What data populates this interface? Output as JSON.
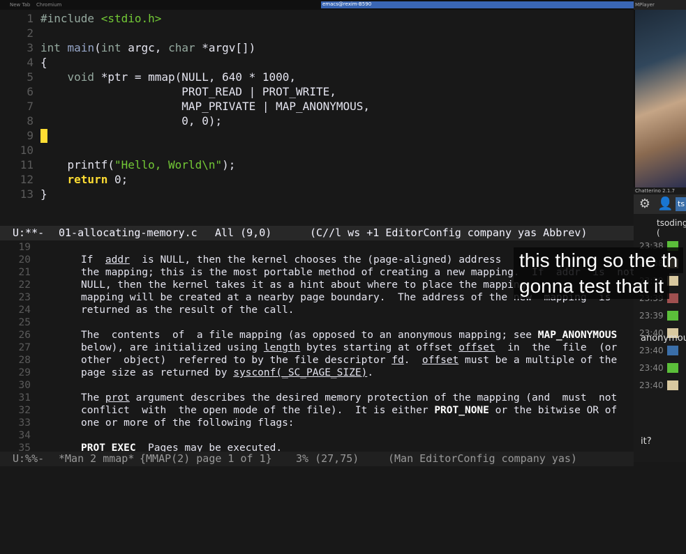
{
  "topbar": {
    "left_tab": "New Tab",
    "left_app": "Chromium",
    "emacs_title": "emacs@rexim-B590",
    "right_title": "MPlayer"
  },
  "code": {
    "lines": [
      {
        "n": "1",
        "parts": [
          {
            "c": "pp",
            "t": "#include "
          },
          {
            "c": "str",
            "t": "<stdio.h>"
          }
        ]
      },
      {
        "n": "2",
        "parts": []
      },
      {
        "n": "3",
        "parts": [
          {
            "c": "ty",
            "t": "int"
          },
          {
            "c": "",
            "t": " "
          },
          {
            "c": "fn",
            "t": "main"
          },
          {
            "c": "",
            "t": "("
          },
          {
            "c": "ty",
            "t": "int"
          },
          {
            "c": "",
            "t": " argc, "
          },
          {
            "c": "ty",
            "t": "char"
          },
          {
            "c": "",
            "t": " *argv[])"
          }
        ]
      },
      {
        "n": "4",
        "parts": [
          {
            "c": "",
            "t": "{"
          }
        ]
      },
      {
        "n": "5",
        "parts": [
          {
            "c": "",
            "t": "    "
          },
          {
            "c": "ty",
            "t": "void"
          },
          {
            "c": "",
            "t": " *ptr = mmap(NULL, 640 * 1000,"
          }
        ]
      },
      {
        "n": "6",
        "parts": [
          {
            "c": "",
            "t": "                     PROT_READ | PROT_WRITE,"
          }
        ]
      },
      {
        "n": "7",
        "parts": [
          {
            "c": "",
            "t": "                     MAP_PRIVATE | MAP_ANONYMOUS,"
          }
        ]
      },
      {
        "n": "8",
        "parts": [
          {
            "c": "",
            "t": "                     0, 0);"
          }
        ]
      },
      {
        "n": "9",
        "parts": []
      },
      {
        "n": "10",
        "parts": []
      },
      {
        "n": "11",
        "parts": [
          {
            "c": "",
            "t": "    printf("
          },
          {
            "c": "str",
            "t": "\"Hello, World\\n\""
          },
          {
            "c": "",
            "t": ");"
          }
        ]
      },
      {
        "n": "12",
        "parts": [
          {
            "c": "",
            "t": "    "
          },
          {
            "c": "kw",
            "t": "return"
          },
          {
            "c": "",
            "t": " 0;"
          }
        ]
      },
      {
        "n": "13",
        "parts": [
          {
            "c": "",
            "t": "}"
          }
        ]
      }
    ]
  },
  "modeline_top": {
    "status": "U:**-",
    "buffer": "01-allocating-memory.c",
    "position": "All (9,0)",
    "modes": "(C//l ws +1 EditorConfig company yas Abbrev)"
  },
  "man": {
    "lines": [
      {
        "n": "19",
        "parts": []
      },
      {
        "n": "20",
        "parts": [
          {
            "c": "",
            "t": "If  "
          },
          {
            "c": "u",
            "t": "addr"
          },
          {
            "c": "",
            "t": "  is NULL, then the kernel chooses the (page-aligned) address"
          }
        ]
      },
      {
        "n": "21",
        "parts": [
          {
            "c": "",
            "t": "the mapping; this is the most portable method of creating a new mapping.  If  addr  is  not"
          }
        ]
      },
      {
        "n": "22",
        "parts": [
          {
            "c": "",
            "t": "NULL, then the kernel takes it as a hint about where to place the mapping;"
          }
        ]
      },
      {
        "n": "23",
        "parts": [
          {
            "c": "",
            "t": "mapping will be created at a nearby page boundary.  The address of the new  mapping  is"
          }
        ]
      },
      {
        "n": "24",
        "parts": [
          {
            "c": "",
            "t": "returned as the result of the call."
          }
        ]
      },
      {
        "n": "25",
        "parts": []
      },
      {
        "n": "26",
        "parts": [
          {
            "c": "",
            "t": "The  contents  of  a file mapping (as opposed to an anonymous mapping; see "
          },
          {
            "c": "b",
            "t": "MAP_ANONYMOUS"
          }
        ]
      },
      {
        "n": "27",
        "parts": [
          {
            "c": "",
            "t": "below), are initialized using "
          },
          {
            "c": "u",
            "t": "length"
          },
          {
            "c": "",
            "t": " bytes starting at offset "
          },
          {
            "c": "u",
            "t": "offset"
          },
          {
            "c": "",
            "t": "  in  the  file  (or"
          }
        ]
      },
      {
        "n": "28",
        "parts": [
          {
            "c": "",
            "t": "other  object)  referred to by the file descriptor "
          },
          {
            "c": "u",
            "t": "fd"
          },
          {
            "c": "",
            "t": ".  "
          },
          {
            "c": "u",
            "t": "offset"
          },
          {
            "c": "",
            "t": " must be a multiple of the"
          }
        ]
      },
      {
        "n": "29",
        "parts": [
          {
            "c": "",
            "t": "page size as returned by "
          },
          {
            "c": "u",
            "t": "sysconf(_SC_PAGE_SIZE)"
          },
          {
            "c": "",
            "t": "."
          }
        ]
      },
      {
        "n": "30",
        "parts": []
      },
      {
        "n": "31",
        "parts": [
          {
            "c": "",
            "t": "The "
          },
          {
            "c": "u",
            "t": "prot"
          },
          {
            "c": "",
            "t": " argument describes the desired memory protection of the mapping (and  must  not"
          }
        ]
      },
      {
        "n": "32",
        "parts": [
          {
            "c": "",
            "t": "conflict  with  the open mode of the file).  It is either "
          },
          {
            "c": "b",
            "t": "PROT_NONE"
          },
          {
            "c": "",
            "t": " or the bitwise OR of"
          }
        ]
      },
      {
        "n": "33",
        "parts": [
          {
            "c": "",
            "t": "one or more of the following flags:"
          }
        ]
      },
      {
        "n": "34",
        "parts": []
      },
      {
        "n": "35",
        "parts": [
          {
            "c": "b",
            "t": "PROT_EXEC"
          },
          {
            "c": "",
            "t": "  Pages may be executed."
          }
        ]
      }
    ]
  },
  "modeline_bottom": {
    "status": "U:%%-",
    "buffer": "*Man 2 mmap*",
    "header": "{MMAP(2) page 1 of 1}",
    "position": "3% (27,75)",
    "modes": "(Man EditorConfig company yas)"
  },
  "captions": {
    "line1": "this thing so the th",
    "line2": "gonna test that it"
  },
  "chatterino": {
    "title": "Chatterino 2.1.7",
    "tab_name": "ts",
    "channel": "tsoding (",
    "messages": [
      {
        "time": "23:38",
        "badge": "#5bbf3a"
      },
      {
        "time": "23:38",
        "badge": "#d9c9a0"
      },
      {
        "time": "23:39",
        "badge": "#d9c9a0"
      },
      {
        "time": "23:39",
        "badge": "#a05050"
      },
      {
        "time": "23:39",
        "badge": "#5bbf3a"
      },
      {
        "time": "23:40",
        "badge": "#d9c9a0"
      },
      {
        "time": "23:40",
        "badge": "#3a6ea8"
      },
      {
        "time": "23:40",
        "badge": "#5bbf3a"
      },
      {
        "time": "23:40",
        "badge": "#d9c9a0"
      }
    ],
    "anonymous_text": "anonymous",
    "last_text": "it?",
    "colors": {
      "accent": "#3a6ea8",
      "background": "#1a1a1a"
    }
  }
}
